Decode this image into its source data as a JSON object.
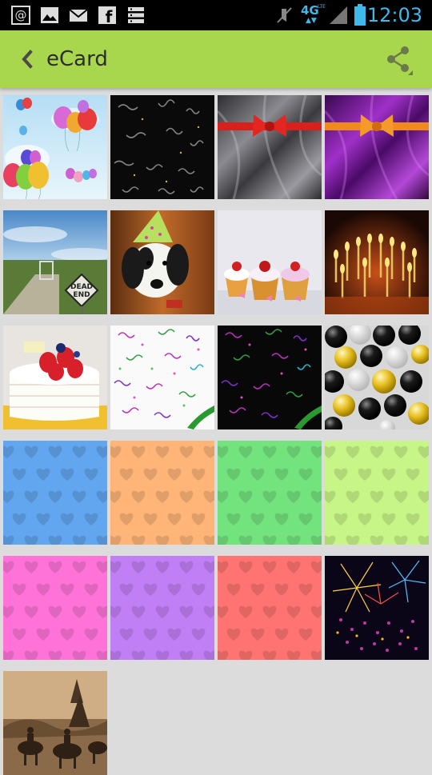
{
  "status_bar": {
    "time": "12:03",
    "network": "4G",
    "network_sub": "LTE",
    "icons": [
      "at-sign-icon",
      "gallery-icon",
      "mail-icon",
      "facebook-icon",
      "list-icon",
      "mute-icon",
      "signal-icon",
      "battery-icon"
    ],
    "accent": "#3fb8ea"
  },
  "app_bar": {
    "title": "eCard",
    "background": "#a8d64c",
    "back_icon": "chevron-left-icon",
    "share_icon": "share-icon"
  },
  "gallery": {
    "items": [
      {
        "name": "balloons",
        "kind": "photo"
      },
      {
        "name": "black-streamers",
        "kind": "photo"
      },
      {
        "name": "silver-satin-red-bow",
        "kind": "photo"
      },
      {
        "name": "purple-satin-orange-bow",
        "kind": "photo"
      },
      {
        "name": "dead-end-sign",
        "kind": "photo",
        "sign_text_line1": "DEAD",
        "sign_text_line2": "END"
      },
      {
        "name": "dog-party-hat",
        "kind": "photo"
      },
      {
        "name": "cupcakes",
        "kind": "photo"
      },
      {
        "name": "candles",
        "kind": "photo"
      },
      {
        "name": "strawberry-cake",
        "kind": "photo"
      },
      {
        "name": "white-confetti",
        "kind": "photo"
      },
      {
        "name": "black-confetti",
        "kind": "photo"
      },
      {
        "name": "black-gold-balloons",
        "kind": "photo"
      },
      {
        "name": "blue-pattern",
        "kind": "pattern",
        "color": "#62a6ef"
      },
      {
        "name": "orange-pattern",
        "kind": "pattern",
        "color": "#ffb577"
      },
      {
        "name": "green-pattern",
        "kind": "pattern",
        "color": "#73e37e"
      },
      {
        "name": "lime-pattern",
        "kind": "pattern",
        "color": "#c8f587"
      },
      {
        "name": "pink-pattern",
        "kind": "pattern",
        "color": "#ff73d9"
      },
      {
        "name": "violet-pattern",
        "kind": "pattern",
        "color": "#c17ff6"
      },
      {
        "name": "coral-pattern",
        "kind": "pattern",
        "color": "#ff7472"
      },
      {
        "name": "fireworks",
        "kind": "photo"
      },
      {
        "name": "sepia-old-photo",
        "kind": "photo"
      }
    ]
  }
}
